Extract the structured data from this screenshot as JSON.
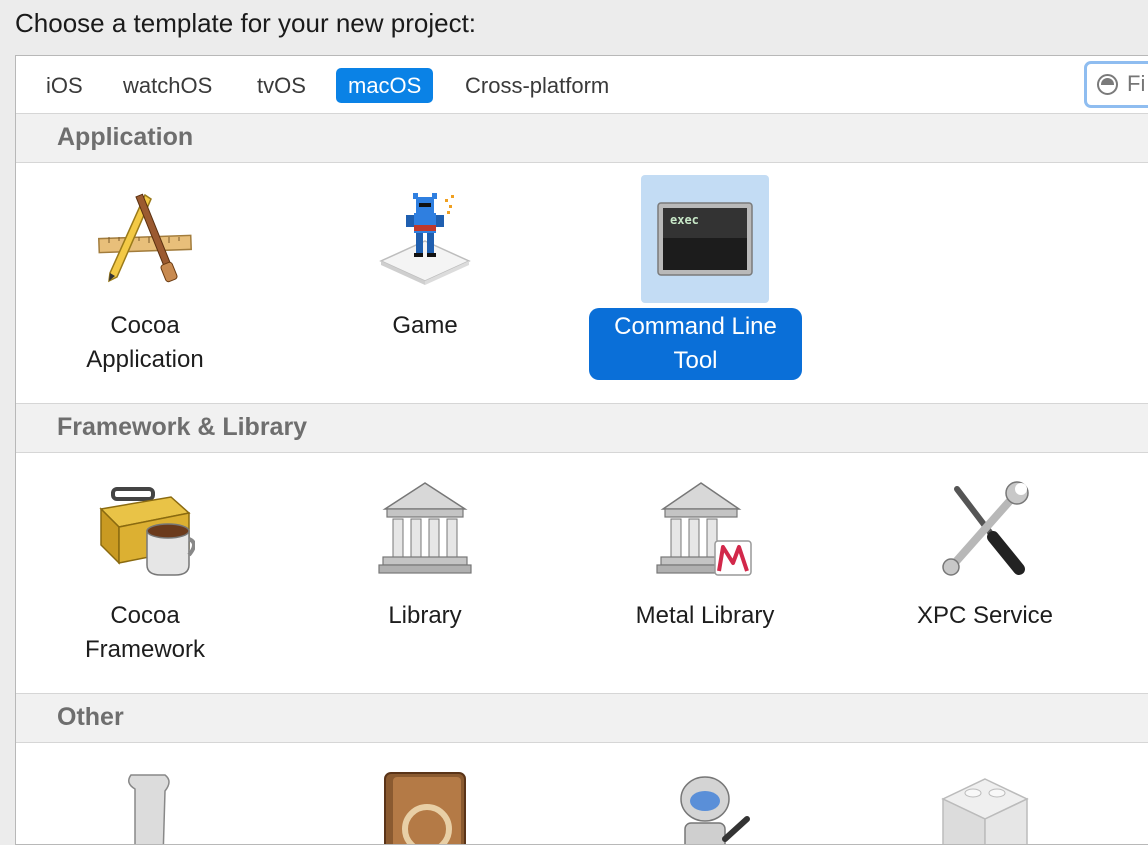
{
  "prompt": "Choose a template for your new project:",
  "tabs": [
    {
      "label": "iOS",
      "selected": false
    },
    {
      "label": "watchOS",
      "selected": false
    },
    {
      "label": "tvOS",
      "selected": false
    },
    {
      "label": "macOS",
      "selected": true
    },
    {
      "label": "Cross-platform",
      "selected": false
    }
  ],
  "filter": {
    "placeholder": "Fi"
  },
  "sections": {
    "application": {
      "title": "Application",
      "items": [
        {
          "line1": "Cocoa",
          "line2": "Application",
          "icon": "cocoa-app-icon"
        },
        {
          "line1": "Game",
          "line2": "",
          "icon": "game-icon"
        },
        {
          "line1": "Command Line",
          "line2": "Tool",
          "icon": "terminal-icon",
          "icon_text": "exec",
          "selected": true
        }
      ]
    },
    "framework": {
      "title": "Framework & Library",
      "items": [
        {
          "line1": "Cocoa",
          "line2": "Framework",
          "icon": "toolbox-icon"
        },
        {
          "line1": "Library",
          "line2": "",
          "icon": "library-icon"
        },
        {
          "line1": "Metal Library",
          "line2": "",
          "icon": "metal-library-icon"
        },
        {
          "line1": "XPC Service",
          "line2": "",
          "icon": "tools-icon"
        }
      ]
    },
    "other": {
      "title": "Other"
    }
  },
  "colors": {
    "accent": "#0a82e6",
    "selection_fill": "#c3dcf4",
    "selected_label": "#0a6fd8"
  }
}
